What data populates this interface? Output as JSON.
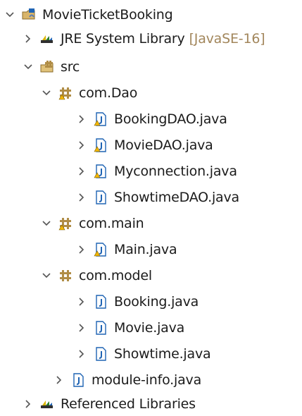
{
  "tree": {
    "project": {
      "label": "MovieTicketBooking",
      "icon": "java-project-icon",
      "expanded": true
    },
    "jre_library": {
      "label": "JRE System Library",
      "decoration": "[JavaSE-16]",
      "icon": "library-icon",
      "expanded": false
    },
    "src_folder": {
      "label": "src",
      "icon": "source-folder-icon",
      "expanded": true
    },
    "packages": [
      {
        "label": "com.Dao",
        "icon": "package-icon",
        "expanded": true,
        "files": [
          {
            "label": "BookingDAO.java",
            "icon": "java-file-warning-icon",
            "expanded": false
          },
          {
            "label": "MovieDAO.java",
            "icon": "java-file-warning-icon",
            "expanded": false
          },
          {
            "label": "Myconnection.java",
            "icon": "java-file-warning-icon",
            "expanded": false
          },
          {
            "label": "ShowtimeDAO.java",
            "icon": "java-file-icon",
            "expanded": false
          }
        ]
      },
      {
        "label": "com.main",
        "icon": "package-icon",
        "expanded": true,
        "files": [
          {
            "label": "Main.java",
            "icon": "java-file-warning-icon",
            "expanded": false
          }
        ]
      },
      {
        "label": "com.model",
        "icon": "package-icon",
        "expanded": true,
        "files": [
          {
            "label": "Booking.java",
            "icon": "java-file-icon",
            "expanded": false
          },
          {
            "label": "Movie.java",
            "icon": "java-file-icon",
            "expanded": false
          },
          {
            "label": "Showtime.java",
            "icon": "java-file-icon",
            "expanded": false
          }
        ]
      }
    ],
    "module_info": {
      "label": "module-info.java",
      "icon": "java-file-icon",
      "expanded": false
    },
    "referenced_libraries": {
      "label": "Referenced Libraries",
      "icon": "library-icon",
      "expanded": false
    }
  },
  "colors": {
    "text": "#1b1b1b",
    "decoration": "#a2865b",
    "chevron": "#555555",
    "package_brown": "#b08d46",
    "java_blue": "#1f64b4",
    "warning_yellow": "#f2b705"
  }
}
